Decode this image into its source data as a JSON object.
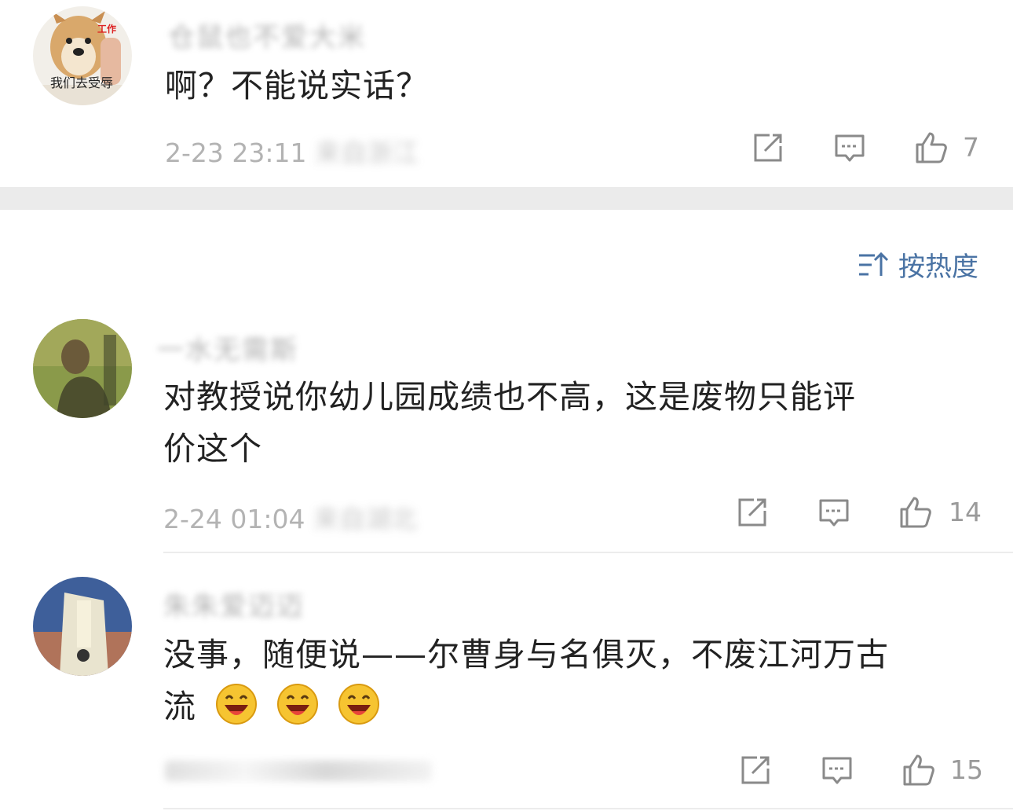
{
  "comments": [
    {
      "username": "仓鼠也不爱大米",
      "avatar_caption": "我们去受辱",
      "avatar_tag": "工作",
      "text_lines": [
        "啊？不能说实话？"
      ],
      "date": "2-23 23:11",
      "location": "来自浙江",
      "likes": "7"
    },
    {
      "username": "一水无需斯",
      "text_lines": [
        "对教授说你幼儿园成绩也不高，这是废物只能评",
        "价这个"
      ],
      "date": "2-24 01:04",
      "location": "来自湖北",
      "likes": "14"
    },
    {
      "username": "朱朱爱迈迈",
      "text_lines": [
        "没事，随便说——尔曹身与名俱灭，不废江河万古",
        "流"
      ],
      "emojis": [
        "laugh-emoji",
        "laugh-emoji",
        "laugh-emoji"
      ],
      "likes": "15"
    }
  ],
  "sort": {
    "label": "按热度",
    "icon": "sort-icon"
  },
  "icons": {
    "share": "share-icon",
    "comment": "comment-icon",
    "like": "thumbs-up-icon"
  },
  "colors": {
    "accent": "#4a73a4",
    "meta": "#b3b3b3",
    "text": "#222222",
    "band": "#ebebeb"
  }
}
